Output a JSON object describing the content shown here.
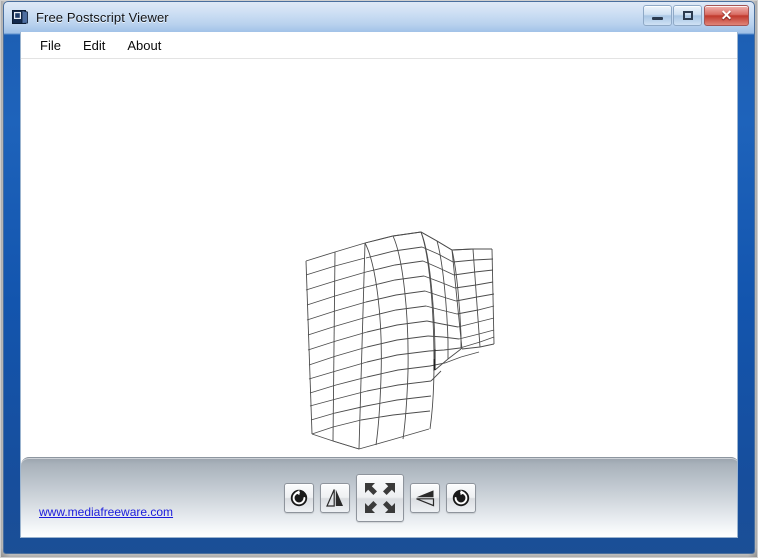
{
  "window": {
    "title": "Free Postscript Viewer",
    "icon": "document-app-icon",
    "controls": {
      "minimize": "minimize-button",
      "maximize": "maximize-button",
      "close": "✕"
    }
  },
  "menu": {
    "items": [
      {
        "label": "File"
      },
      {
        "label": "Edit"
      },
      {
        "label": "About"
      }
    ]
  },
  "document": {
    "type": "postscript-wireframe-mesh",
    "description": "3D wireframe surface mesh rendering"
  },
  "footer": {
    "link_text": "www.mediafreeware.com",
    "link_color": "#1b1bdc",
    "buttons": [
      {
        "name": "rotate-left-button",
        "icon": "rotate-counterclockwise-icon"
      },
      {
        "name": "flip-horizontal-button",
        "icon": "flip-horizontal-icon"
      },
      {
        "name": "fit-to-window-button",
        "icon": "expand-arrows-icon"
      },
      {
        "name": "flip-vertical-button",
        "icon": "flip-vertical-icon"
      },
      {
        "name": "rotate-right-button",
        "icon": "rotate-clockwise-icon"
      }
    ]
  },
  "chart_data": {
    "type": "line",
    "title": "",
    "xlabel": "",
    "ylabel": "",
    "description": "Wireframe mesh surface of a folded / creased sheet drawn in oblique 3D projection, black hairlines on white background",
    "rows": 13,
    "cols": 9,
    "grid": true,
    "legend": "none"
  }
}
